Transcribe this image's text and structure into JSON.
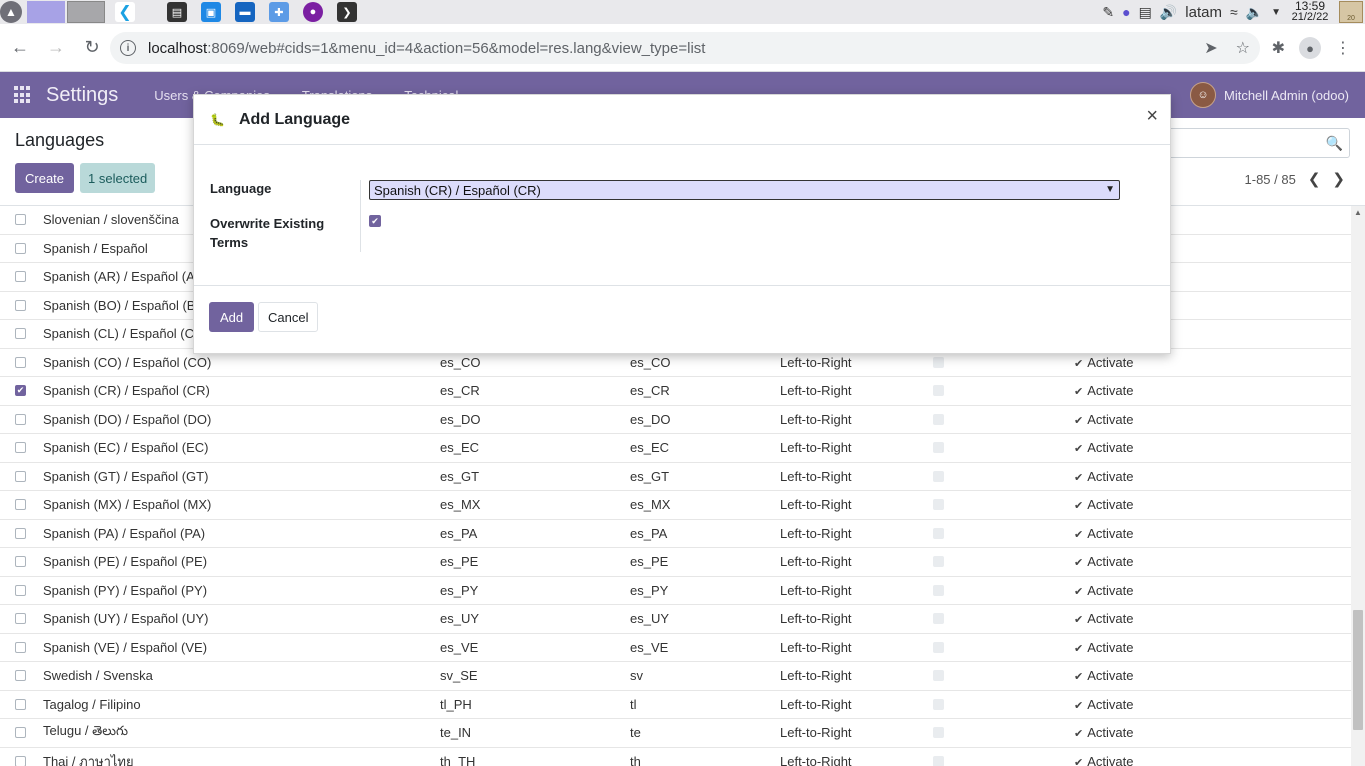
{
  "taskbar": {
    "clock_time": "13:59",
    "clock_date": "21/2/22",
    "keyboard_layout": "latam",
    "note_label": "20"
  },
  "browser": {
    "url_host": "localhost",
    "url_path": ":8069/web#cids=1&menu_id=4&action=56&model=res.lang&view_type=list"
  },
  "navbar": {
    "brand": "Settings",
    "menu": [
      "Users & Companies",
      "Translations",
      "Technical"
    ],
    "user": "Mitchell Admin (odoo)"
  },
  "control_panel": {
    "breadcrumb": "Languages",
    "create_label": "Create",
    "selected_label": "1 selected",
    "pager": "1-85 / 85"
  },
  "rows": [
    {
      "name": "Slovenian / slovenščina",
      "code": "",
      "iso": "",
      "dir": "",
      "checked": false
    },
    {
      "name": "Spanish / Español",
      "code": "",
      "iso": "",
      "dir": "",
      "checked": false
    },
    {
      "name": "Spanish (AR) / Español (AR)",
      "code": "",
      "iso": "",
      "dir": "",
      "checked": false
    },
    {
      "name": "Spanish (BO) / Español (BO)",
      "code": "",
      "iso": "",
      "dir": "",
      "checked": false
    },
    {
      "name": "Spanish (CL) / Español (CL)",
      "code": "",
      "iso": "",
      "dir": "",
      "checked": false
    },
    {
      "name": "Spanish (CO) / Español (CO)",
      "code": "es_CO",
      "iso": "es_CO",
      "dir": "Left-to-Right",
      "checked": false
    },
    {
      "name": "Spanish (CR) / Español (CR)",
      "code": "es_CR",
      "iso": "es_CR",
      "dir": "Left-to-Right",
      "checked": true
    },
    {
      "name": "Spanish (DO) / Español (DO)",
      "code": "es_DO",
      "iso": "es_DO",
      "dir": "Left-to-Right",
      "checked": false
    },
    {
      "name": "Spanish (EC) / Español (EC)",
      "code": "es_EC",
      "iso": "es_EC",
      "dir": "Left-to-Right",
      "checked": false
    },
    {
      "name": "Spanish (GT) / Español (GT)",
      "code": "es_GT",
      "iso": "es_GT",
      "dir": "Left-to-Right",
      "checked": false
    },
    {
      "name": "Spanish (MX) / Español (MX)",
      "code": "es_MX",
      "iso": "es_MX",
      "dir": "Left-to-Right",
      "checked": false
    },
    {
      "name": "Spanish (PA) / Español (PA)",
      "code": "es_PA",
      "iso": "es_PA",
      "dir": "Left-to-Right",
      "checked": false
    },
    {
      "name": "Spanish (PE) / Español (PE)",
      "code": "es_PE",
      "iso": "es_PE",
      "dir": "Left-to-Right",
      "checked": false
    },
    {
      "name": "Spanish (PY) / Español (PY)",
      "code": "es_PY",
      "iso": "es_PY",
      "dir": "Left-to-Right",
      "checked": false
    },
    {
      "name": "Spanish (UY) / Español (UY)",
      "code": "es_UY",
      "iso": "es_UY",
      "dir": "Left-to-Right",
      "checked": false
    },
    {
      "name": "Spanish (VE) / Español (VE)",
      "code": "es_VE",
      "iso": "es_VE",
      "dir": "Left-to-Right",
      "checked": false
    },
    {
      "name": "Swedish / Svenska",
      "code": "sv_SE",
      "iso": "sv",
      "dir": "Left-to-Right",
      "checked": false
    },
    {
      "name": "Tagalog / Filipino",
      "code": "tl_PH",
      "iso": "tl",
      "dir": "Left-to-Right",
      "checked": false
    },
    {
      "name": "Telugu / తెలుగు",
      "code": "te_IN",
      "iso": "te",
      "dir": "Left-to-Right",
      "checked": false
    },
    {
      "name": "Thai / ภาษาไทย",
      "code": "th_TH",
      "iso": "th",
      "dir": "Left-to-Right",
      "checked": false
    }
  ],
  "activate_label": "Activate",
  "modal": {
    "title": "Add Language",
    "language_label": "Language",
    "language_value": "Spanish (CR) / Español (CR)",
    "overwrite_label": "Overwrite Existing Terms",
    "overwrite_checked": true,
    "add_label": "Add",
    "cancel_label": "Cancel"
  },
  "colors": {
    "brand": "#71639e",
    "selected_badge": "#b9d9d9"
  }
}
